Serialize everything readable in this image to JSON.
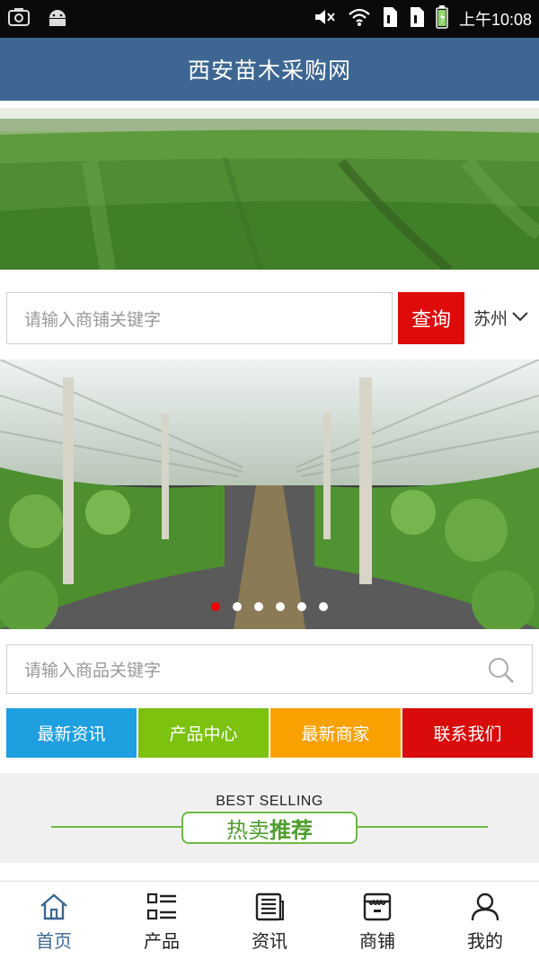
{
  "status_bar": {
    "time": "上午10:08",
    "left_icons": [
      "screenshot-icon",
      "android-icon"
    ],
    "right_icons": [
      "mute-icon",
      "wifi-icon",
      "sim1-icon",
      "sim2-icon",
      "battery-icon"
    ]
  },
  "header": {
    "title": "西安苗木采购网"
  },
  "shop_search": {
    "placeholder": "请输入商铺关键字",
    "button_label": "查询",
    "city": "苏州"
  },
  "carousel": {
    "dot_count": 6,
    "active_index": 0
  },
  "product_search": {
    "placeholder": "请输入商品关键字"
  },
  "nav_buttons": [
    {
      "label": "最新资讯",
      "color": "#1d9fe0"
    },
    {
      "label": "产品中心",
      "color": "#7cc20f"
    },
    {
      "label": "最新商家",
      "color": "#f9a100"
    },
    {
      "label": "联系我们",
      "color": "#d90b0b"
    }
  ],
  "hot_section": {
    "subtitle": "BEST SELLING",
    "title_part1": "热卖",
    "title_part2": "推荐"
  },
  "tab_bar": {
    "items": [
      {
        "label": "首页",
        "icon": "home-icon",
        "active": true
      },
      {
        "label": "产品",
        "icon": "grid-list-icon",
        "active": false
      },
      {
        "label": "资讯",
        "icon": "news-icon",
        "active": false
      },
      {
        "label": "商铺",
        "icon": "store-icon",
        "active": false
      },
      {
        "label": "我的",
        "icon": "user-icon",
        "active": false
      }
    ]
  },
  "colors": {
    "header_bg": "#3d6792",
    "accent_red": "#df0a0a",
    "hot_green": "#6bbb42"
  }
}
